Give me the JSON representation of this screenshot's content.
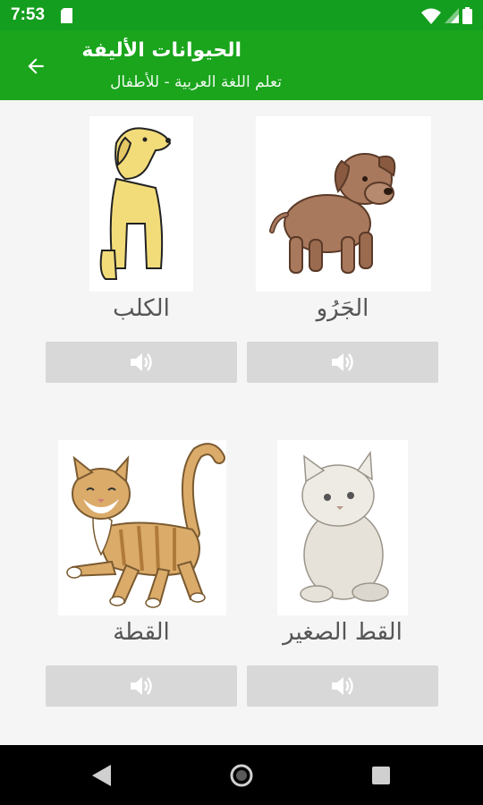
{
  "status_bar": {
    "time": "7:53",
    "icons": [
      "sd-card-icon",
      "wifi-icon",
      "signal-icon",
      "battery-icon"
    ]
  },
  "app_bar": {
    "back_icon": "arrow-back-icon",
    "title": "الحيوانات الأليفة",
    "subtitle": "تعلم اللغة العربية - للأطفال",
    "color": "#1aa51c"
  },
  "cards": [
    {
      "label": "الجَرُو",
      "image": "puppy-image",
      "button_icon": "speaker-icon"
    },
    {
      "label": "الكلب",
      "image": "dog-image",
      "button_icon": "speaker-icon"
    },
    {
      "label": "القط الصغير",
      "image": "kitten-image",
      "button_icon": "speaker-icon"
    },
    {
      "label": "القطة",
      "image": "cat-image",
      "button_icon": "speaker-icon"
    }
  ],
  "nav_bar": {
    "buttons": [
      "back-triangle-icon",
      "home-circle-icon",
      "recents-square-icon"
    ]
  }
}
